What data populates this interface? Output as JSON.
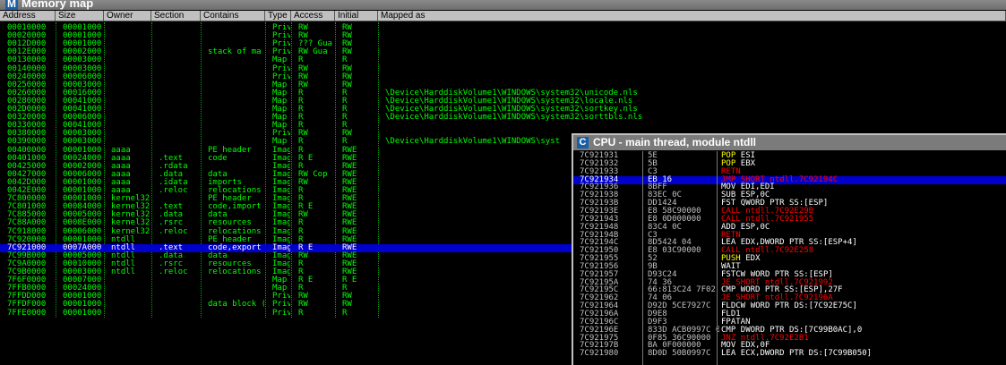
{
  "memory_map": {
    "icon_letter": "M",
    "title": "Memory map",
    "columns": [
      "Address",
      "Size",
      "Owner",
      "Section",
      "Contains",
      "Type",
      "Access",
      "Initial",
      "Mapped as"
    ],
    "rows": [
      {
        "address": "00010000",
        "size": "00001000",
        "owner": "",
        "section": "",
        "contains": "",
        "type": "Priv",
        "access": "RW",
        "initial": "RW",
        "mapped": ""
      },
      {
        "address": "00020000",
        "size": "00001000",
        "owner": "",
        "section": "",
        "contains": "",
        "type": "Priv",
        "access": "RW",
        "initial": "RW",
        "mapped": ""
      },
      {
        "address": "0012D000",
        "size": "00001000",
        "owner": "",
        "section": "",
        "contains": "",
        "type": "Priv",
        "access": "??? Gua",
        "initial": "RW",
        "mapped": ""
      },
      {
        "address": "0012E000",
        "size": "00002000",
        "owner": "",
        "section": "",
        "contains": "stack of ma",
        "type": "Priv",
        "access": "RW  Gua",
        "initial": "RW",
        "mapped": ""
      },
      {
        "address": "00130000",
        "size": "00003000",
        "owner": "",
        "section": "",
        "contains": "",
        "type": "Map",
        "access": "R",
        "initial": "R",
        "mapped": ""
      },
      {
        "address": "00140000",
        "size": "00003000",
        "owner": "",
        "section": "",
        "contains": "",
        "type": "Priv",
        "access": "RW",
        "initial": "RW",
        "mapped": ""
      },
      {
        "address": "00240000",
        "size": "00006000",
        "owner": "",
        "section": "",
        "contains": "",
        "type": "Priv",
        "access": "RW",
        "initial": "RW",
        "mapped": ""
      },
      {
        "address": "00250000",
        "size": "00003000",
        "owner": "",
        "section": "",
        "contains": "",
        "type": "Map",
        "access": "RW",
        "initial": "RW",
        "mapped": ""
      },
      {
        "address": "00260000",
        "size": "00016000",
        "owner": "",
        "section": "",
        "contains": "",
        "type": "Map",
        "access": "R",
        "initial": "R",
        "mapped": "\\Device\\HarddiskVolume1\\WINDOWS\\system32\\unicode.nls"
      },
      {
        "address": "00280000",
        "size": "00041000",
        "owner": "",
        "section": "",
        "contains": "",
        "type": "Map",
        "access": "R",
        "initial": "R",
        "mapped": "\\Device\\HarddiskVolume1\\WINDOWS\\system32\\locale.nls"
      },
      {
        "address": "002D0000",
        "size": "00041000",
        "owner": "",
        "section": "",
        "contains": "",
        "type": "Map",
        "access": "R",
        "initial": "R",
        "mapped": "\\Device\\HarddiskVolume1\\WINDOWS\\system32\\sortkey.nls"
      },
      {
        "address": "00320000",
        "size": "00006000",
        "owner": "",
        "section": "",
        "contains": "",
        "type": "Map",
        "access": "R",
        "initial": "R",
        "mapped": "\\Device\\HarddiskVolume1\\WINDOWS\\system32\\sorttbls.nls"
      },
      {
        "address": "00330000",
        "size": "00041000",
        "owner": "",
        "section": "",
        "contains": "",
        "type": "Map",
        "access": "R",
        "initial": "R",
        "mapped": ""
      },
      {
        "address": "00380000",
        "size": "00003000",
        "owner": "",
        "section": "",
        "contains": "",
        "type": "Priv",
        "access": "RW",
        "initial": "RW",
        "mapped": ""
      },
      {
        "address": "00390000",
        "size": "00003000",
        "owner": "",
        "section": "",
        "contains": "",
        "type": "Map",
        "access": "R",
        "initial": "R",
        "mapped": "\\Device\\HarddiskVolume1\\WINDOWS\\syst"
      },
      {
        "address": "00400000",
        "size": "00001000",
        "owner": "aaaa",
        "section": "",
        "contains": "PE header",
        "type": "Imag",
        "access": "R",
        "initial": "RWE",
        "mapped": ""
      },
      {
        "address": "00401000",
        "size": "00024000",
        "owner": "aaaa",
        "section": ".text",
        "contains": "code",
        "type": "Imag",
        "access": "R E",
        "initial": "RWE",
        "mapped": ""
      },
      {
        "address": "00425000",
        "size": "00002000",
        "owner": "aaaa",
        "section": ".rdata",
        "contains": "",
        "type": "Imag",
        "access": "R",
        "initial": "RWE",
        "mapped": ""
      },
      {
        "address": "00427000",
        "size": "00006000",
        "owner": "aaaa",
        "section": ".data",
        "contains": "data",
        "type": "Imag",
        "access": "RW  Cop",
        "initial": "RWE",
        "mapped": ""
      },
      {
        "address": "0042D000",
        "size": "00001000",
        "owner": "aaaa",
        "section": ".idata",
        "contains": "imports",
        "type": "Imag",
        "access": "RW",
        "initial": "RWE",
        "mapped": ""
      },
      {
        "address": "0042E000",
        "size": "00001000",
        "owner": "aaaa",
        "section": ".reloc",
        "contains": "relocations",
        "type": "Imag",
        "access": "R",
        "initial": "RWE",
        "mapped": ""
      },
      {
        "address": "7C800000",
        "size": "00001000",
        "owner": "kernel32",
        "section": "",
        "contains": "PE header",
        "type": "Imag",
        "access": "R",
        "initial": "RWE",
        "mapped": ""
      },
      {
        "address": "7C801000",
        "size": "00084000",
        "owner": "kernel32",
        "section": ".text",
        "contains": "code,import",
        "type": "Imag",
        "access": "R E",
        "initial": "RWE",
        "mapped": ""
      },
      {
        "address": "7C885000",
        "size": "00005000",
        "owner": "kernel32",
        "section": ".data",
        "contains": "data",
        "type": "Imag",
        "access": "RW",
        "initial": "RWE",
        "mapped": ""
      },
      {
        "address": "7C88A000",
        "size": "0008E000",
        "owner": "kernel32",
        "section": ".rsrc",
        "contains": "resources",
        "type": "Imag",
        "access": "R",
        "initial": "RWE",
        "mapped": ""
      },
      {
        "address": "7C918000",
        "size": "00006000",
        "owner": "kernel32",
        "section": ".reloc",
        "contains": "relocations",
        "type": "Imag",
        "access": "R",
        "initial": "RWE",
        "mapped": ""
      },
      {
        "address": "7C920000",
        "size": "00001000",
        "owner": "ntdll",
        "section": "",
        "contains": "PE header",
        "type": "Imag",
        "access": "R",
        "initial": "RWE",
        "mapped": ""
      },
      {
        "address": "7C921000",
        "size": "0007A000",
        "owner": "ntdll",
        "section": ".text",
        "contains": "code,export",
        "type": "Imag",
        "access": "R E",
        "initial": "RWE",
        "mapped": ""
      },
      {
        "address": "7C99B000",
        "size": "00005000",
        "owner": "ntdll",
        "section": ".data",
        "contains": "data",
        "type": "Imag",
        "access": "RW",
        "initial": "RWE",
        "mapped": ""
      },
      {
        "address": "7C9A0000",
        "size": "00010000",
        "owner": "ntdll",
        "section": ".rsrc",
        "contains": "resources",
        "type": "Imag",
        "access": "R",
        "initial": "RWE",
        "mapped": ""
      },
      {
        "address": "7C9B0000",
        "size": "00003000",
        "owner": "ntdll",
        "section": ".reloc",
        "contains": "relocations",
        "type": "Imag",
        "access": "R",
        "initial": "RWE",
        "mapped": ""
      },
      {
        "address": "7F6F0000",
        "size": "00007000",
        "owner": "",
        "section": "",
        "contains": "",
        "type": "Map",
        "access": "R E",
        "initial": "R E",
        "mapped": ""
      },
      {
        "address": "7FFB0000",
        "size": "00024000",
        "owner": "",
        "section": "",
        "contains": "",
        "type": "Map",
        "access": "R",
        "initial": "R",
        "mapped": ""
      },
      {
        "address": "7FFDD000",
        "size": "00001000",
        "owner": "",
        "section": "",
        "contains": "",
        "type": "Priv",
        "access": "RW",
        "initial": "RW",
        "mapped": ""
      },
      {
        "address": "7FFDF000",
        "size": "00001000",
        "owner": "",
        "section": "",
        "contains": "data block (",
        "type": "Priv",
        "access": "RW",
        "initial": "RW",
        "mapped": ""
      },
      {
        "address": "7FFE0000",
        "size": "00001000",
        "owner": "",
        "section": "",
        "contains": "",
        "type": "Priv",
        "access": "R",
        "initial": "R",
        "mapped": ""
      }
    ],
    "selected_row": 27
  },
  "cpu": {
    "icon_letter": "C",
    "title": "CPU - main thread, module ntdll",
    "rows": [
      {
        "addr": "7C921931",
        "hex": "5E",
        "mn": "POP",
        "op": "ESI",
        "mnc": "yellow"
      },
      {
        "addr": "7C921932",
        "hex": "5B",
        "mn": "POP",
        "op": "EBX",
        "mnc": "yellow"
      },
      {
        "addr": "7C921933",
        "hex": "C3",
        "mn": "RETN",
        "op": "",
        "mnc": "red"
      },
      {
        "addr": "7C921934",
        "hex": "EB 16",
        "mn": "JMP",
        "op": "SHORT ntdll.7C92194C",
        "mnc": "yellow"
      },
      {
        "addr": "7C921936",
        "hex": "8BFF",
        "mn": "MOV",
        "op": "EDI,EDI",
        "mnc": "white"
      },
      {
        "addr": "7C921938",
        "hex": "83EC 0C",
        "mn": "SUB",
        "op": "ESP,0C",
        "mnc": "white"
      },
      {
        "addr": "7C92193B",
        "hex": "DD1424",
        "mn": "FST",
        "op": "QWORD PTR SS:[ESP]",
        "mnc": "white"
      },
      {
        "addr": "7C92193E",
        "hex": "E8 58C90000",
        "mn": "CALL",
        "op": "ntdll.7C92E29B",
        "mnc": "red"
      },
      {
        "addr": "7C921943",
        "hex": "E8 0D000000",
        "mn": "CALL",
        "op": "ntdll.7C921955",
        "mnc": "red"
      },
      {
        "addr": "7C921948",
        "hex": "83C4 0C",
        "mn": "ADD",
        "op": "ESP,0C",
        "mnc": "white"
      },
      {
        "addr": "7C92194B",
        "hex": "C3",
        "mn": "RETN",
        "op": "",
        "mnc": "red"
      },
      {
        "addr": "7C92194C",
        "hex": "8D5424 04",
        "mn": "LEA",
        "op": "EDX,DWORD PTR SS:[ESP+4]",
        "mnc": "white"
      },
      {
        "addr": "7C921950",
        "hex": "E8 03C90000",
        "mn": "CALL",
        "op": "ntdll.7C92E258",
        "mnc": "red"
      },
      {
        "addr": "7C921955",
        "hex": "52",
        "mn": "PUSH",
        "op": "EDX",
        "mnc": "yellow"
      },
      {
        "addr": "7C921956",
        "hex": "9B",
        "mn": "WAIT",
        "op": "",
        "mnc": "white"
      },
      {
        "addr": "7C921957",
        "hex": "D93C24",
        "mn": "FSTCW",
        "op": "WORD PTR SS:[ESP]",
        "mnc": "white"
      },
      {
        "addr": "7C92195A",
        "hex": "74 36",
        "mn": "JE",
        "op": "SHORT ntdll.7C921992",
        "mnc": "red"
      },
      {
        "addr": "7C92195C",
        "hex": "66:813C24 7F02",
        "mn": "CMP",
        "op": "WORD PTR SS:[ESP],27F",
        "mnc": "white"
      },
      {
        "addr": "7C921962",
        "hex": "74 06",
        "mn": "JE",
        "op": "SHORT ntdll.7C92196A",
        "mnc": "red"
      },
      {
        "addr": "7C921964",
        "hex": "D92D 5CE7927C",
        "mn": "FLDCW",
        "op": "WORD PTR DS:[7C92E75C]",
        "mnc": "white"
      },
      {
        "addr": "7C92196A",
        "hex": "D9E8",
        "mn": "FLD1",
        "op": "",
        "mnc": "white"
      },
      {
        "addr": "7C92196C",
        "hex": "D9F3",
        "mn": "FPATAN",
        "op": "",
        "mnc": "white"
      },
      {
        "addr": "7C92196E",
        "hex": "833D ACB0997C 0(",
        "mn": "CMP",
        "op": "DWORD PTR DS:[7C99B0AC],0",
        "mnc": "white"
      },
      {
        "addr": "7C921975",
        "hex": "0F85 36C90000",
        "mn": "JNZ",
        "op": "ntdll.7C92E2B1",
        "mnc": "red"
      },
      {
        "addr": "7C92197B",
        "hex": "BA 0F000000",
        "mn": "MOV",
        "op": "EDX,0F",
        "mnc": "white"
      },
      {
        "addr": "7C921980",
        "hex": "8D0D 50B0997C",
        "mn": "LEA",
        "op": "ECX,DWORD PTR DS:[7C99B050]",
        "mnc": "white"
      }
    ],
    "selected_row": 3
  }
}
